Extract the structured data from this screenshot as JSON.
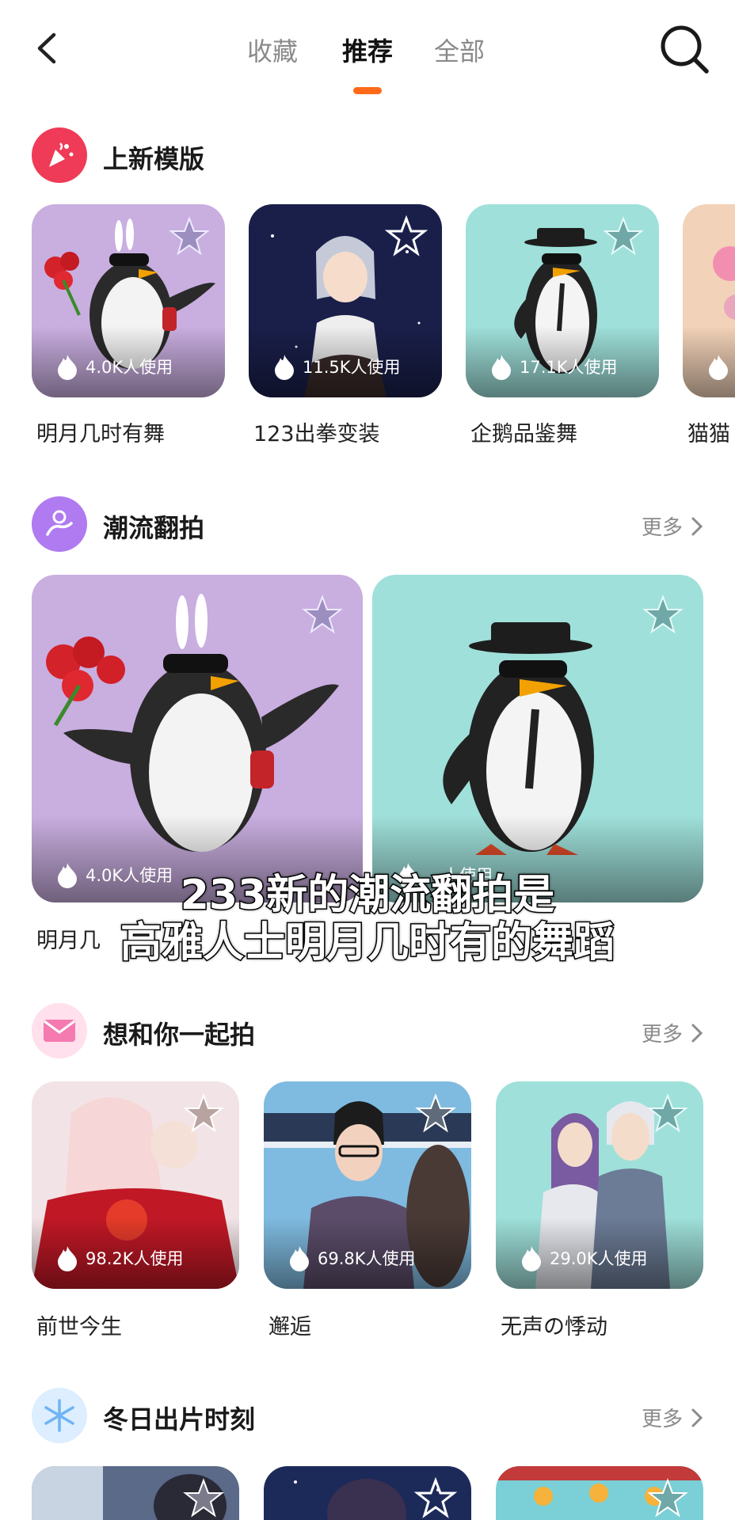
{
  "header": {
    "tabs": [
      {
        "label": "收藏"
      },
      {
        "label": "推荐"
      },
      {
        "label": "全部"
      }
    ],
    "accent_color": "#ff6a1a"
  },
  "icons": {
    "back": "chevron-left-icon",
    "search": "search-icon",
    "star": "star-icon",
    "usage": "flame-icon",
    "more": "chevron-right-icon"
  },
  "sections": [
    {
      "title": "上新模版",
      "icon": "confetti-icon",
      "icon_color": "#ef3b57",
      "items": [
        {
          "usage": "4.0K人使用",
          "title": "明月几时有舞"
        },
        {
          "usage": "11.5K人使用",
          "title": "123出拳变装"
        },
        {
          "usage": "17.1K人使用",
          "title": "企鹅品鉴舞"
        },
        {
          "usage": "",
          "title": "猫猫"
        }
      ]
    },
    {
      "title": "潮流翻拍",
      "icon": "dancer-icon",
      "icon_color": "#b07af0",
      "more": "更多",
      "items": [
        {
          "usage": "4.0K人使用",
          "title": "明月几"
        },
        {
          "usage": "…人使用",
          "title": ""
        }
      ]
    },
    {
      "title": "想和你一起拍",
      "icon": "envelope-icon",
      "icon_color": "#f47ab0",
      "more": "更多",
      "items": [
        {
          "usage": "98.2K人使用",
          "title": "前世今生"
        },
        {
          "usage": "69.8K人使用",
          "title": "邂逅"
        },
        {
          "usage": "29.0K人使用",
          "title": "无声の悸动"
        }
      ]
    },
    {
      "title": "冬日出片时刻",
      "icon": "snowflake-icon",
      "icon_color": "#8ec8ff",
      "more": "更多",
      "items": [
        {
          "usage": "",
          "title": ""
        },
        {
          "usage": "",
          "title": ""
        },
        {
          "usage": "",
          "title": ""
        }
      ]
    }
  ],
  "subtitle": {
    "line1": "233新的潮流翻拍是",
    "line2": "高雅人士明月几时有的舞蹈"
  }
}
